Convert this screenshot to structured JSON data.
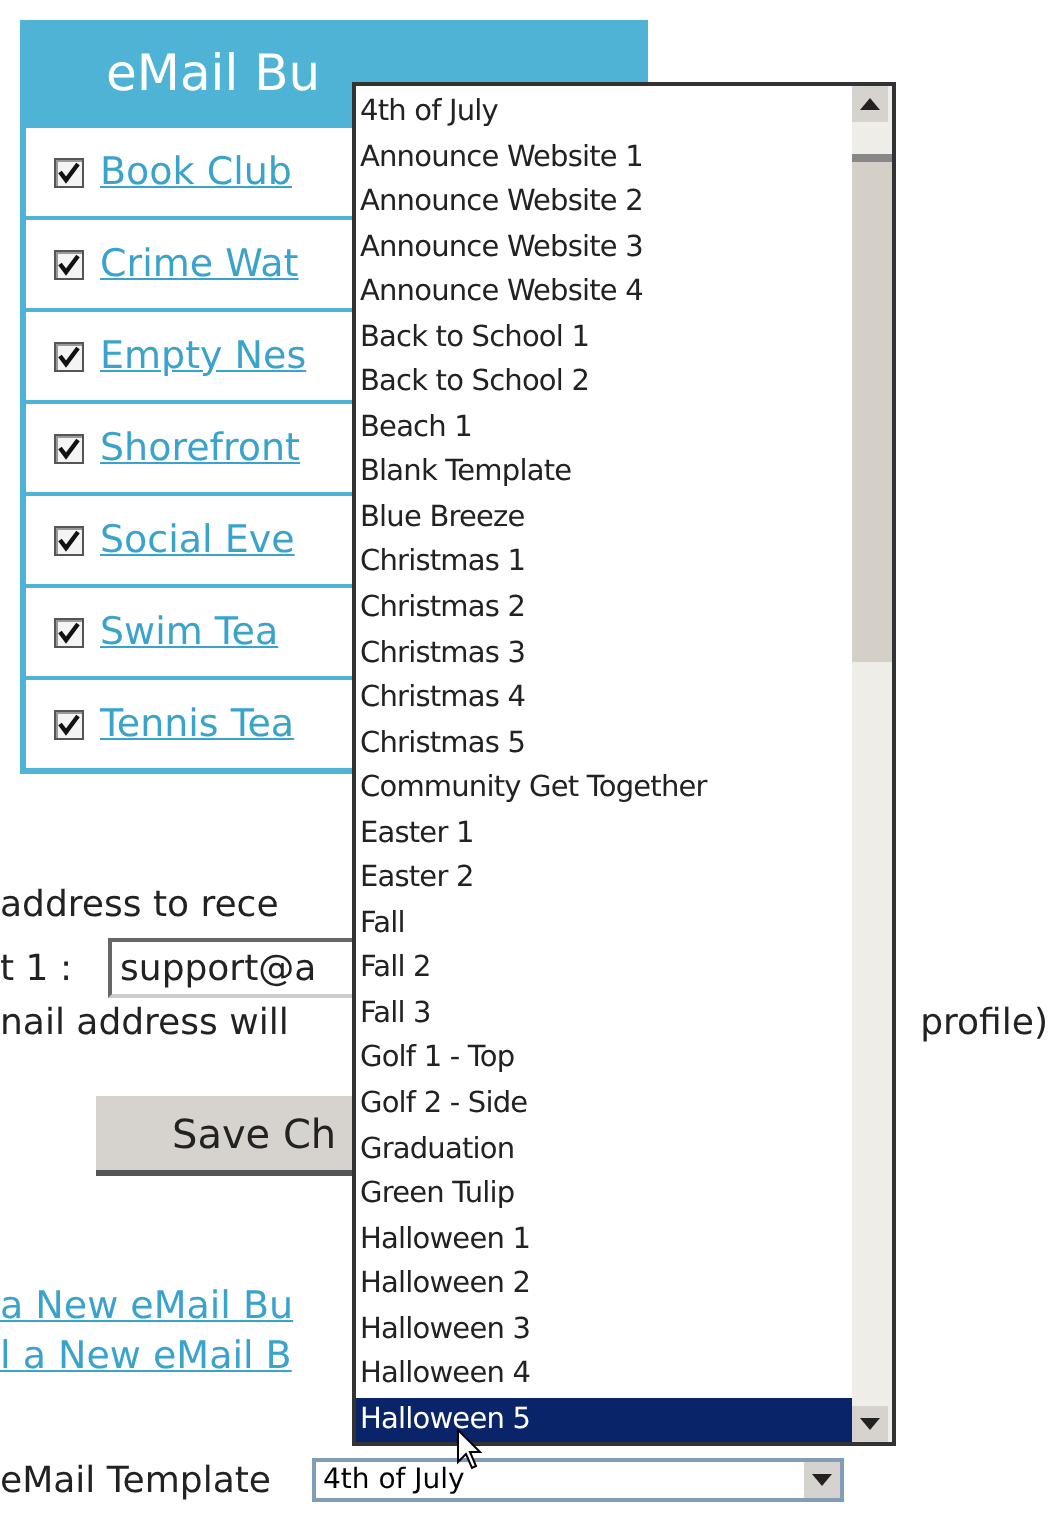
{
  "bulletins": {
    "title": "eMail Bu",
    "items": [
      {
        "label": "Book Club",
        "checked": true
      },
      {
        "label": "Crime Wat",
        "checked": true
      },
      {
        "label": "Empty Nes",
        "checked": true
      },
      {
        "label": "Shorefront",
        "checked": true
      },
      {
        "label": "Social Eve",
        "checked": true
      },
      {
        "label": "Swim Tea",
        "checked": true
      },
      {
        "label": "Tennis Tea",
        "checked": true
      }
    ]
  },
  "address_prompt": "address to rece",
  "email_field": {
    "label": "t 1 :",
    "value": "support@a"
  },
  "address_note": {
    "left": "nail address will",
    "right": "profile)"
  },
  "save_button": "Save Ch",
  "links": [
    "a New eMail Bu",
    "l a New eMail B"
  ],
  "template": {
    "label": "eMail Template",
    "value": "4th of July"
  },
  "template_options": [
    {
      "label": "4th of July",
      "selected": false
    },
    {
      "label": "Announce Website 1",
      "selected": false
    },
    {
      "label": "Announce Website 2",
      "selected": false
    },
    {
      "label": "Announce Website 3",
      "selected": false
    },
    {
      "label": "Announce Website 4",
      "selected": false
    },
    {
      "label": "Back to School 1",
      "selected": false
    },
    {
      "label": "Back to School 2",
      "selected": false
    },
    {
      "label": "Beach 1",
      "selected": false
    },
    {
      "label": "Blank Template",
      "selected": false
    },
    {
      "label": "Blue Breeze",
      "selected": false
    },
    {
      "label": "Christmas 1",
      "selected": false
    },
    {
      "label": "Christmas 2",
      "selected": false
    },
    {
      "label": "Christmas 3",
      "selected": false
    },
    {
      "label": "Christmas 4",
      "selected": false
    },
    {
      "label": "Christmas 5",
      "selected": false
    },
    {
      "label": "Community Get Together",
      "selected": false
    },
    {
      "label": "Easter 1",
      "selected": false
    },
    {
      "label": "Easter 2",
      "selected": false
    },
    {
      "label": "Fall",
      "selected": false
    },
    {
      "label": "Fall 2",
      "selected": false
    },
    {
      "label": "Fall 3",
      "selected": false
    },
    {
      "label": "Golf 1 - Top",
      "selected": false
    },
    {
      "label": "Golf 2 - Side",
      "selected": false
    },
    {
      "label": "Graduation",
      "selected": false
    },
    {
      "label": "Green Tulip",
      "selected": false
    },
    {
      "label": "Halloween 1",
      "selected": false
    },
    {
      "label": "Halloween 2",
      "selected": false
    },
    {
      "label": "Halloween 3",
      "selected": false
    },
    {
      "label": "Halloween 4",
      "selected": false
    },
    {
      "label": "Halloween 5",
      "selected": true
    }
  ]
}
